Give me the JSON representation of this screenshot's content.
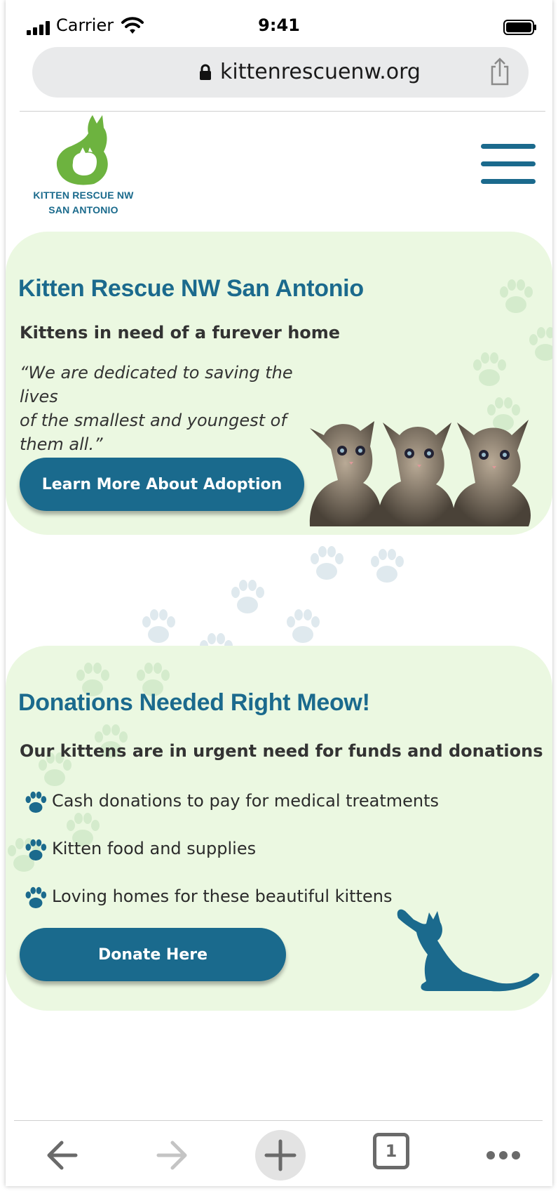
{
  "status_bar": {
    "carrier": "Carrier",
    "time": "9:41"
  },
  "browser": {
    "url": "kittenrescuenw.org",
    "tab_count": "1"
  },
  "header": {
    "logo_line1": "KITTEN RESCUE NW",
    "logo_line2": "SAN ANTONIO"
  },
  "hero": {
    "title": "Kitten Rescue NW San Antonio",
    "subtitle": "Kittens in need of a furever home",
    "quote_line1": "“We are dedicated to saving the lives",
    "quote_line2": "of the smallest and youngest of",
    "quote_line3": "them all.”",
    "button_label": "Learn More About Adoption"
  },
  "donations": {
    "title": "Donations Needed Right Meow!",
    "subtitle": "Our kittens are in urgent need for funds and donations",
    "items": [
      "Cash donations to pay for medical treatments",
      "Kitten food and supplies",
      "Loving homes for these beautiful kittens"
    ],
    "button_label": "Donate Here"
  },
  "colors": {
    "brand_blue": "#1b6a8d",
    "card_green": "#ebf8e1",
    "logo_green": "#6db33f"
  },
  "icons": [
    "signal-icon",
    "wifi-icon",
    "battery-icon",
    "lock-icon",
    "share-icon",
    "hamburger-menu-icon",
    "paw-icon",
    "back-icon",
    "forward-icon",
    "new-tab-icon",
    "tabs-icon",
    "more-icon"
  ]
}
